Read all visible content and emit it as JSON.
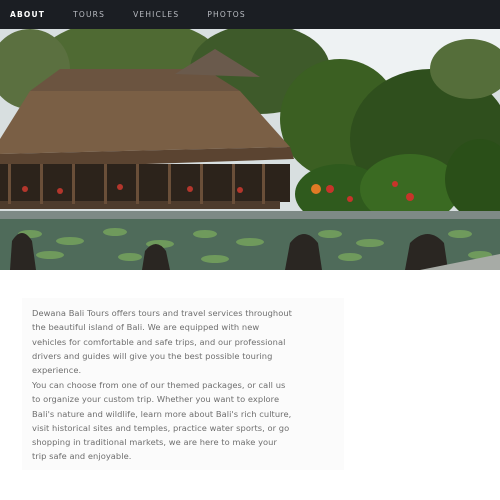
{
  "nav": {
    "items": [
      {
        "label": "ABOUT",
        "active": true
      },
      {
        "label": "TOURS",
        "active": false
      },
      {
        "label": "VEHICLES",
        "active": false
      },
      {
        "label": "PHOTOS",
        "active": false
      }
    ]
  },
  "about": {
    "paragraph1": "Dewana Bali Tours offers tours and travel services throughout the beautiful island of Bali. We are equipped with new vehicles for comfortable and safe trips, and our professional drivers and guides will give you the best possible touring experience.",
    "paragraph2": "You can choose from one of our themed packages, or call us to organize your custom trip. Whether you want to explore Bali's nature and wildlife, learn more about Bali's rich culture, visit historical sites and temples, practice water sports, or go shopping in traditional markets, we are here to make your trip safe and enjoyable."
  },
  "colors": {
    "nav_background": "#1b1e23",
    "nav_text": "#b9bcc2",
    "nav_active": "#ffffff",
    "body_text": "#6e6e6e",
    "content_panel": "#fbfbfb"
  }
}
